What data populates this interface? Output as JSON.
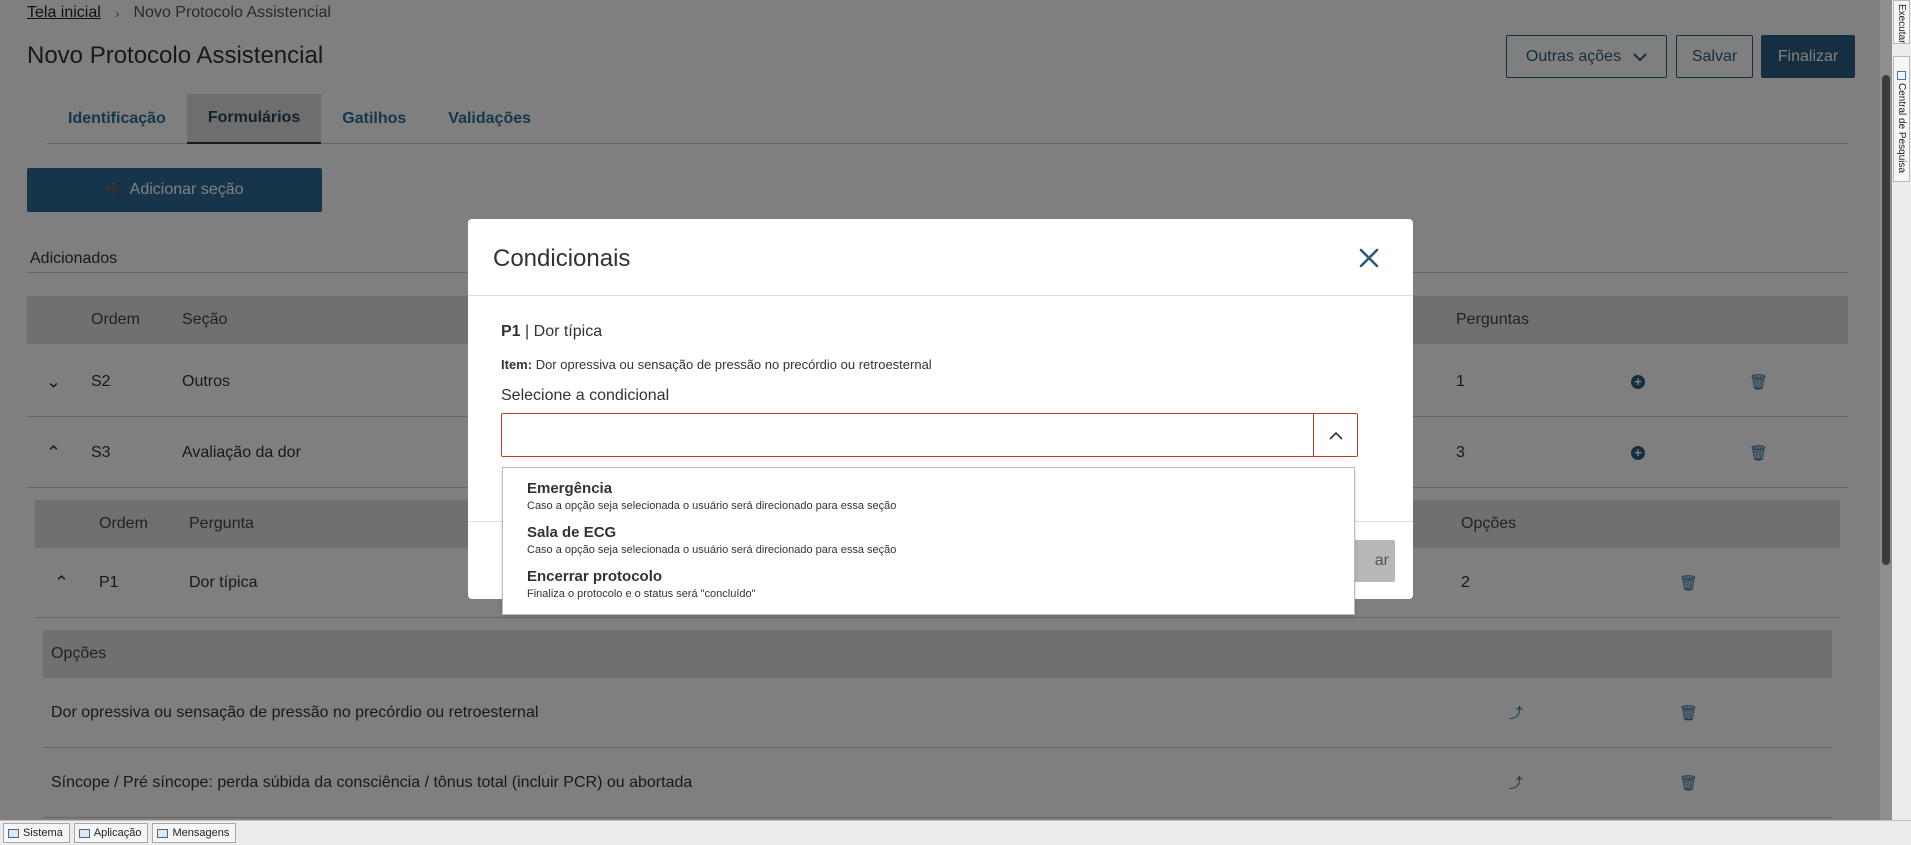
{
  "breadcrumb": {
    "home": "Tela inicial",
    "current": "Novo Protocolo Assistencial"
  },
  "page_title": "Novo Protocolo Assistencial",
  "header_buttons": {
    "other_actions": "Outras ações",
    "save": "Salvar",
    "finish": "Finalizar"
  },
  "tabs": [
    "Identificação",
    "Formulários",
    "Gatilhos",
    "Validações"
  ],
  "add_section_label": "Adicionar seção",
  "added_label": "Adicionados",
  "sections_table": {
    "headers": {
      "order": "Ordem",
      "section": "Seção",
      "questions": "Perguntas"
    },
    "rows": [
      {
        "order": "S2",
        "section": "Outros",
        "questions": "1"
      },
      {
        "order": "S3",
        "section": "Avaliação da dor",
        "questions": "3"
      }
    ]
  },
  "questions_table": {
    "headers": {
      "order": "Ordem",
      "question": "Pergunta",
      "options": "Opções"
    },
    "rows": [
      {
        "order": "P1",
        "question": "Dor típica",
        "options": "2"
      }
    ]
  },
  "options_table": {
    "header": "Opções",
    "rows": [
      "Dor opressiva ou sensação de pressão no precórdio ou retroesternal",
      "Síncope / Pré síncope: perda súbida da consciência / tônus total (incluir PCR) ou abortada"
    ]
  },
  "modal": {
    "title": "Condicionais",
    "question_code": "P1",
    "question_text": "| Dor típica",
    "item_label": "Item:",
    "item_text": "Dor opressiva ou sensação de pressão no precórdio ou retroesternal",
    "select_label": "Selecione a condicional",
    "select_value": "",
    "footer_button_partial": "ar",
    "options": [
      {
        "title": "Emergência",
        "desc": "Caso a opção seja selecionada o usuário será direcionado para essa seção"
      },
      {
        "title": "Sala de ECG",
        "desc": "Caso a opção seja selecionada o usuário será direcionado para essa seção"
      },
      {
        "title": "Encerrar protocolo",
        "desc": "Finaliza o protocolo e o status será \"concluído\""
      }
    ]
  },
  "right_tabs": {
    "execute": "Executar",
    "research": "Central de Pesquisa"
  },
  "taskbar": [
    "Sistema",
    "Aplicação",
    "Mensagens"
  ],
  "colors": {
    "primary": "#2b5d80",
    "error_border": "#c0392b",
    "overlay": "rgba(0,0,0,0.5)"
  },
  "icons": {
    "close": "close-icon",
    "chevron_up": "chevron-up-icon",
    "chevron_down": "chevron-down-icon",
    "add": "plus-circle-icon",
    "delete": "trash-icon",
    "connect": "branch-icon"
  }
}
